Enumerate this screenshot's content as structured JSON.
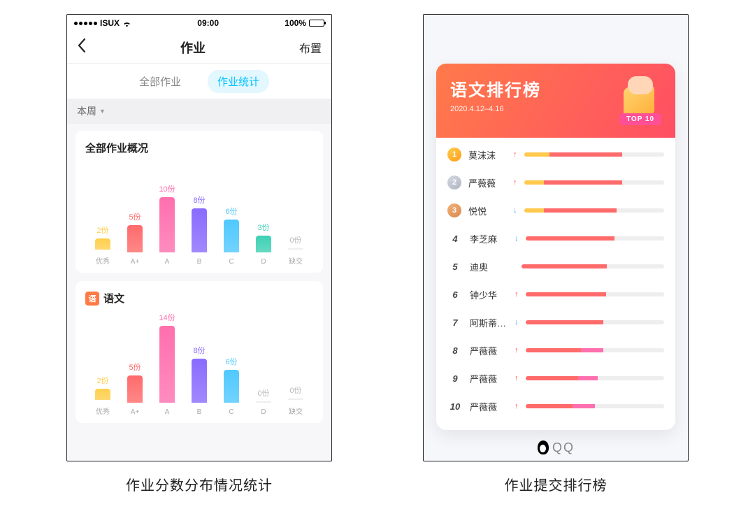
{
  "left": {
    "status": {
      "carrier": "ISUX",
      "time": "09:00",
      "battery": "100%"
    },
    "nav": {
      "title": "作业",
      "action": "布置"
    },
    "tabs": {
      "all": "全部作业",
      "stats": "作业统计"
    },
    "filter": {
      "label": "本周"
    },
    "card_all_title": "全部作业概况",
    "card_sub_badge": "语",
    "card_sub_title": "语文",
    "caption": "作业分数分布情况统计"
  },
  "right": {
    "header": {
      "title": "语文排行榜",
      "date": "2020.4.12–4.16",
      "ribbon": "TOP 10"
    },
    "rows": [
      {
        "rank": "1",
        "name": "莫沫沫",
        "trend": "up",
        "seg": [
          18,
          52,
          0,
          30
        ]
      },
      {
        "rank": "2",
        "name": "严薇薇",
        "trend": "up",
        "seg": [
          14,
          56,
          0,
          30
        ]
      },
      {
        "rank": "3",
        "name": "悦悦",
        "trend": "down",
        "seg": [
          14,
          52,
          0,
          34
        ]
      },
      {
        "rank": "4",
        "name": "李芝麻",
        "trend": "down",
        "seg": [
          0,
          64,
          0,
          36
        ]
      },
      {
        "rank": "5",
        "name": "迪奥",
        "trend": "",
        "seg": [
          0,
          60,
          0,
          40
        ]
      },
      {
        "rank": "6",
        "name": "钟少华",
        "trend": "up",
        "seg": [
          0,
          58,
          0,
          42
        ]
      },
      {
        "rank": "7",
        "name": "阿斯蒂…",
        "trend": "down",
        "seg": [
          0,
          56,
          0,
          44
        ]
      },
      {
        "rank": "8",
        "name": "严薇薇",
        "trend": "up",
        "seg": [
          0,
          40,
          16,
          44
        ]
      },
      {
        "rank": "9",
        "name": "严薇薇",
        "trend": "up",
        "seg": [
          0,
          38,
          14,
          48
        ]
      },
      {
        "rank": "10",
        "name": "严薇薇",
        "trend": "up",
        "seg": [
          0,
          34,
          16,
          50
        ]
      }
    ],
    "footer": "QQ",
    "caption": "作业提交排行榜"
  },
  "chart_data": [
    {
      "type": "bar",
      "title": "全部作业概况",
      "unit": "份",
      "ylim": [
        0,
        14
      ],
      "categories": [
        "优秀",
        "A+",
        "A",
        "B",
        "C",
        "D",
        "缺交"
      ],
      "values": [
        2,
        5,
        10,
        8,
        6,
        3,
        0
      ],
      "colors": [
        "#ffcf4d",
        "#ff6a6a",
        "#ff6fae",
        "#8a6bff",
        "#4fc8ff",
        "#3ed0b4",
        "#dddddd"
      ]
    },
    {
      "type": "bar",
      "title": "语文",
      "unit": "份",
      "ylim": [
        0,
        14
      ],
      "categories": [
        "优秀",
        "A+",
        "A",
        "B",
        "C",
        "D",
        "缺交"
      ],
      "values": [
        2,
        5,
        14,
        8,
        6,
        0,
        0
      ],
      "colors": [
        "#ffcf4d",
        "#ff6a6a",
        "#ff6fae",
        "#8a6bff",
        "#4fc8ff",
        "#3ed0b4",
        "#dddddd"
      ]
    }
  ]
}
